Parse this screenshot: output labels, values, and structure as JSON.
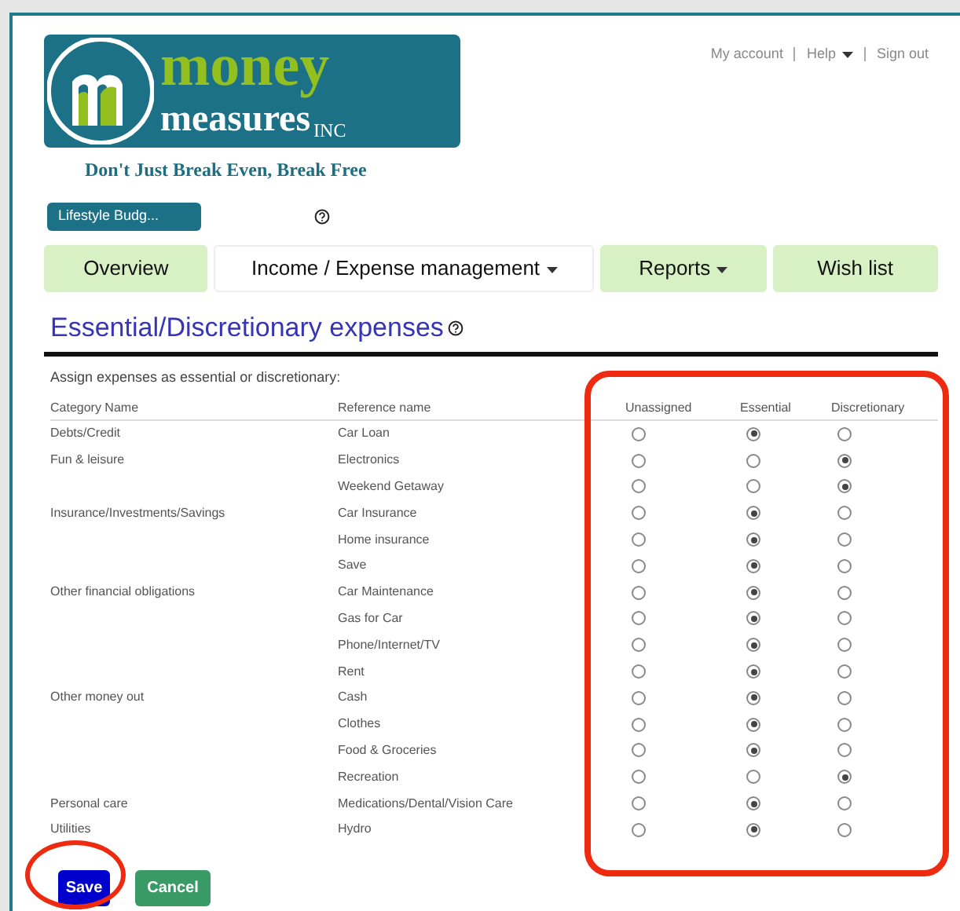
{
  "logo": {
    "word_1": "money",
    "word_2": "measures",
    "suffix": "INC",
    "tagline": "Don't Just Break Even, Break Free"
  },
  "user_menu": [
    {
      "label": "My account",
      "dropdown": false
    },
    {
      "label": "Help",
      "dropdown": true
    },
    {
      "label": "Sign out",
      "dropdown": false
    }
  ],
  "budget_button": "Lifestyle Budg...",
  "tabs": [
    {
      "label": "Overview",
      "selected": false,
      "dropdown": false
    },
    {
      "label": "Income / Expense management",
      "selected": true,
      "dropdown": true
    },
    {
      "label": "Reports",
      "selected": false,
      "dropdown": true
    },
    {
      "label": "Wish list",
      "selected": false,
      "dropdown": false
    }
  ],
  "heading": "Essential/Discretionary expenses",
  "instructions": "Assign expenses as essential or discretionary:",
  "table": {
    "columns": [
      "Category Name",
      "Reference name",
      "Unassigned",
      "Essential",
      "Discretionary"
    ],
    "rows": [
      {
        "category": "Debts/Credit",
        "reference": "Car Loan",
        "options": [
          {
            "selected": false
          },
          {
            "selected": true
          },
          {
            "selected": false
          }
        ]
      },
      {
        "category": "Fun & leisure",
        "reference": "Electronics",
        "options": [
          {
            "selected": false
          },
          {
            "selected": false
          },
          {
            "selected": true
          }
        ]
      },
      {
        "reference": "Weekend Getaway",
        "options": [
          {
            "selected": false
          },
          {
            "selected": false
          },
          {
            "selected": true
          }
        ]
      },
      {
        "category": "Insurance/Investments/Savings",
        "reference": "Car Insurance",
        "options": [
          {
            "selected": false
          },
          {
            "selected": true
          },
          {
            "selected": false
          }
        ]
      },
      {
        "reference": "Home insurance",
        "options": [
          {
            "selected": false
          },
          {
            "selected": true
          },
          {
            "selected": false
          }
        ]
      },
      {
        "reference": "Save",
        "options": [
          {
            "selected": false
          },
          {
            "selected": true
          },
          {
            "selected": false
          }
        ]
      },
      {
        "category": "Other financial obligations",
        "reference": "Car Maintenance",
        "options": [
          {
            "selected": false
          },
          {
            "selected": true
          },
          {
            "selected": false
          }
        ]
      },
      {
        "reference": "Gas for Car",
        "options": [
          {
            "selected": false
          },
          {
            "selected": true
          },
          {
            "selected": false
          }
        ]
      },
      {
        "reference": "Phone/Internet/TV",
        "options": [
          {
            "selected": false
          },
          {
            "selected": true
          },
          {
            "selected": false
          }
        ]
      },
      {
        "reference": "Rent",
        "options": [
          {
            "selected": false
          },
          {
            "selected": true
          },
          {
            "selected": false
          }
        ]
      },
      {
        "category": "Other money out",
        "reference": "Cash",
        "options": [
          {
            "selected": false
          },
          {
            "selected": true
          },
          {
            "selected": false
          }
        ]
      },
      {
        "reference": "Clothes",
        "options": [
          {
            "selected": false
          },
          {
            "selected": true
          },
          {
            "selected": false
          }
        ]
      },
      {
        "reference": "Food & Groceries",
        "options": [
          {
            "selected": false
          },
          {
            "selected": true
          },
          {
            "selected": false
          }
        ]
      },
      {
        "reference": "Recreation",
        "options": [
          {
            "selected": false
          },
          {
            "selected": false
          },
          {
            "selected": true
          }
        ]
      },
      {
        "category": "Personal care",
        "reference": "Medications/Dental/Vision Care",
        "options": [
          {
            "selected": false
          },
          {
            "selected": true
          },
          {
            "selected": false
          }
        ]
      },
      {
        "category": "Utilities",
        "reference": "Hydro",
        "options": [
          {
            "selected": false
          },
          {
            "selected": true
          },
          {
            "selected": false
          }
        ]
      }
    ]
  },
  "buttons": [
    {
      "label": "Save",
      "kind": "primary"
    },
    {
      "label": "Cancel",
      "kind": "secondary"
    }
  ]
}
